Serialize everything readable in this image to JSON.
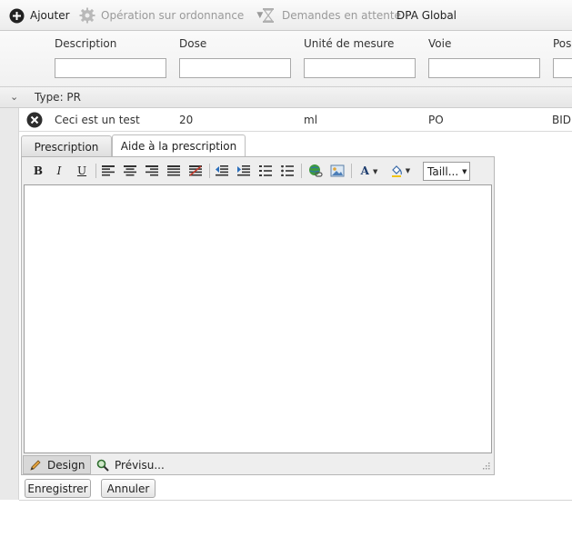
{
  "toolbar": {
    "add_label": "Ajouter",
    "operation_label": "Opération sur ordonnance",
    "pending_label": "Demandes en attente",
    "dpa_label": "DPA Global"
  },
  "grid": {
    "columns": [
      "Description",
      "Dose",
      "Unité de mesure",
      "Voie",
      "Posologie"
    ],
    "group_label": "Type: PR",
    "row": {
      "description": "Ceci est un test",
      "dose": "20",
      "unit": "ml",
      "route": "PO",
      "posology": "BID"
    }
  },
  "tabs": {
    "prescription": "Prescription",
    "aid": "Aide à la prescription"
  },
  "editor": {
    "bold": "B",
    "italic": "I",
    "underline": "U",
    "font_color_glyph": "A",
    "size_label": "Taill...",
    "design_label": "Design",
    "preview_label": "Prévisu..."
  },
  "actions": {
    "save": "Enregistrer",
    "cancel": "Annuler"
  },
  "colors": {
    "accent_link": "#2a6ebb",
    "disabled_text": "#9a9a9a"
  }
}
